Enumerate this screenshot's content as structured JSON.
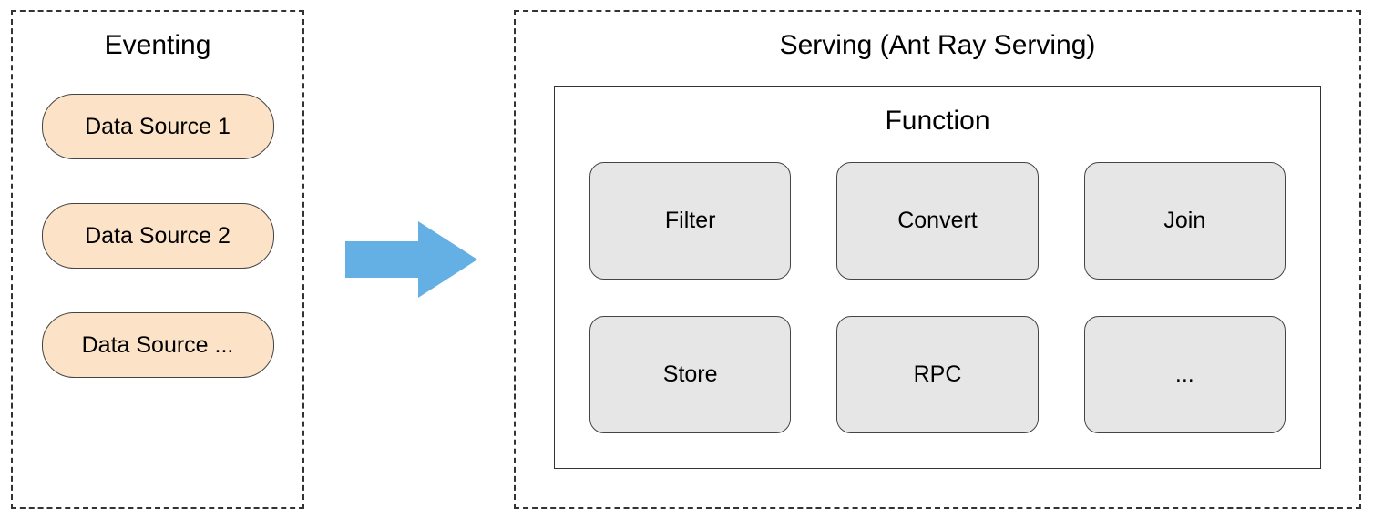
{
  "eventing": {
    "title": "Eventing",
    "sources": {
      "s1": "Data Source 1",
      "s2": "Data Source 2",
      "s3": "Data Source ..."
    }
  },
  "serving": {
    "title": "Serving (Ant Ray Serving)",
    "function_title": "Function",
    "functions": {
      "filter": "Filter",
      "convert": "Convert",
      "join": "Join",
      "store": "Store",
      "rpc": "RPC",
      "more": "..."
    }
  },
  "colors": {
    "source_bg": "#fce2c7",
    "fn_bg": "#e6e6e6",
    "arrow": "#64b0e4"
  }
}
